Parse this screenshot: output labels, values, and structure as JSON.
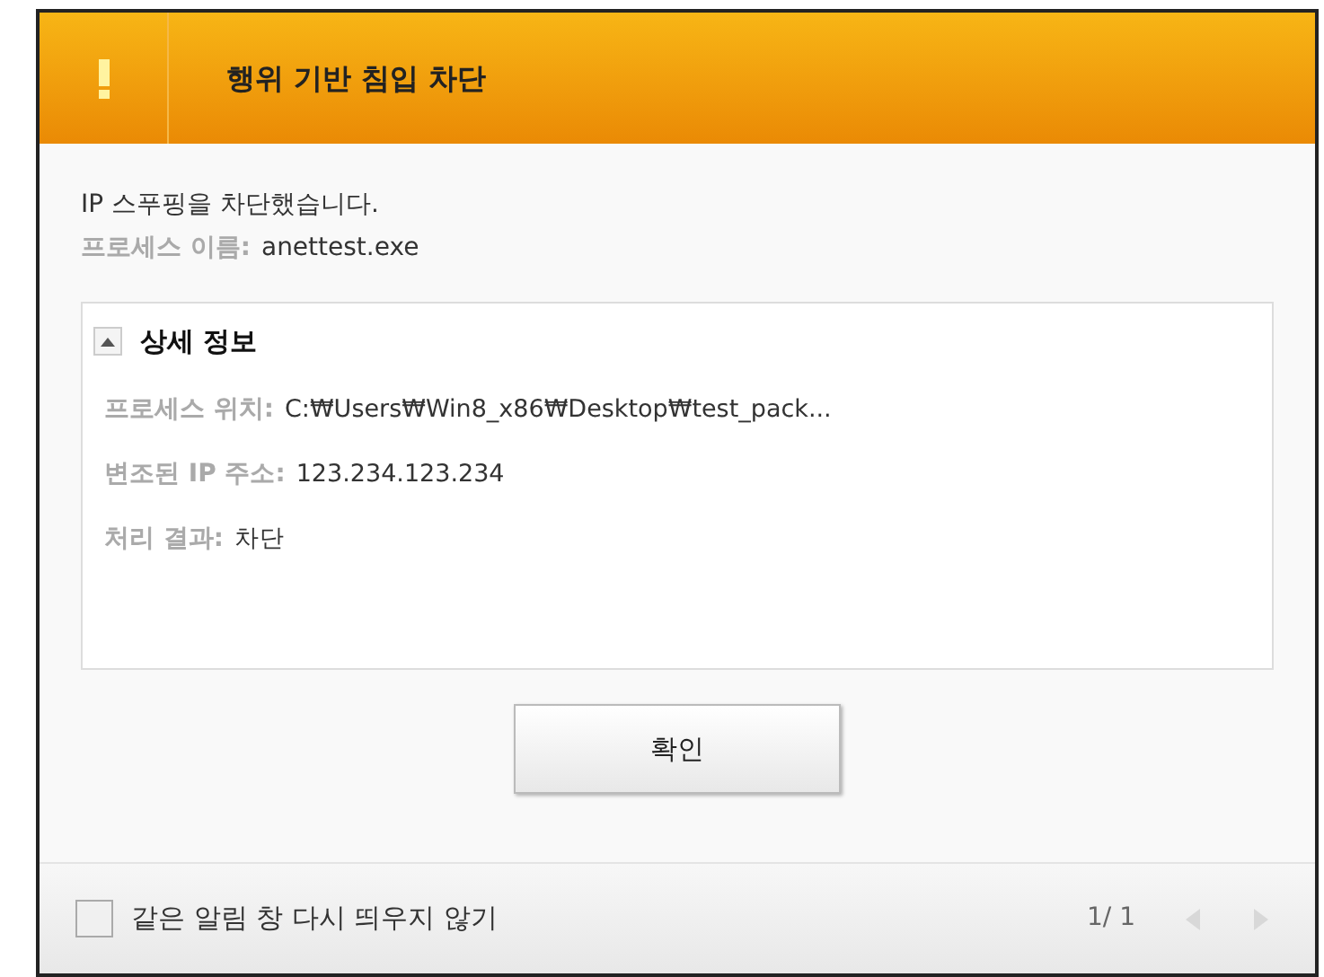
{
  "window": {
    "title": "행위 기반 침입 차단"
  },
  "message": "IP 스푸핑을 차단했습니다.",
  "process_name": {
    "label": "프로세스 이름:",
    "value": "anettest.exe"
  },
  "details": {
    "title": "상세 정보",
    "expanded": true,
    "rows": [
      {
        "label": "프로세스 위치:",
        "value": "C:₩Users₩Win8_x86₩Desktop₩test_pack..."
      },
      {
        "label": "변조된 IP 주소:",
        "value": "123.234.123.234"
      },
      {
        "label": "처리 결과:",
        "value": "차단"
      }
    ]
  },
  "ok_button": "확인",
  "footer": {
    "checkbox": {
      "label": "같은 알림 창 다시 띄우지 않기",
      "checked": false
    },
    "page": "1/ 1",
    "prev_disabled": true,
    "next_disabled": true
  }
}
